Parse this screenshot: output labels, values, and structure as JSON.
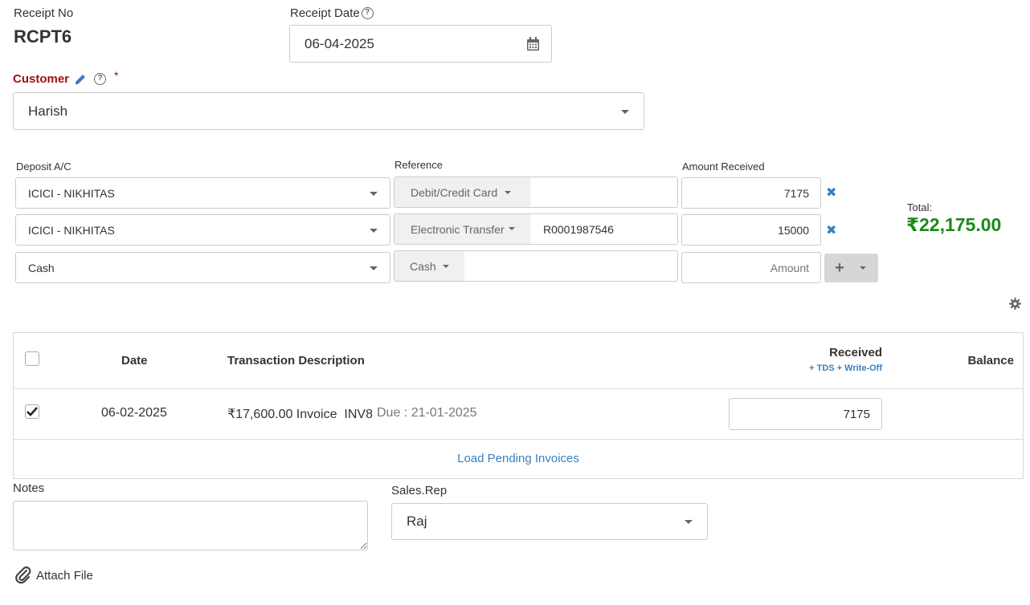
{
  "receipt": {
    "no_label": "Receipt No",
    "no_value": "RCPT6",
    "date_label": "Receipt Date",
    "date_value": "06-04-2025",
    "help_glyph": "?"
  },
  "customer": {
    "label": "Customer",
    "required_mark": "*",
    "value": "Harish"
  },
  "deposits": {
    "account_label": "Deposit A/C",
    "reference_label": "Reference",
    "amount_label": "Amount Received",
    "rows": [
      {
        "account": "ICICI - NIKHITAS",
        "method": "Debit/Credit Card",
        "reference": "",
        "amount": "7175"
      },
      {
        "account": "ICICI - NIKHITAS",
        "method": "Electronic Transfer",
        "reference": "R0001987546",
        "amount": "15000"
      },
      {
        "account": "Cash",
        "method": "Cash",
        "reference": "",
        "amount": ""
      }
    ],
    "amount_placeholder": "Amount",
    "remove_glyph": "✖",
    "add_glyph": "+"
  },
  "total": {
    "label": "Total:",
    "value": "₹22,175.00",
    "color": "#1a8a1a"
  },
  "table": {
    "headers": {
      "date": "Date",
      "description": "Transaction Description",
      "received": "Received",
      "received_sub": "+ TDS + Write-Off",
      "balance": "Balance"
    },
    "rows": [
      {
        "checked": true,
        "date": "06-02-2025",
        "description": "₹17,600.00 Invoice  INV8",
        "due": "Due : 21-01-2025",
        "received": "7175",
        "balance": ""
      }
    ],
    "load_link": "Load Pending Invoices"
  },
  "notes": {
    "label": "Notes",
    "value": ""
  },
  "sales_rep": {
    "label": "Sales.Rep",
    "value": "Raj"
  },
  "attach": {
    "label": "Attach File"
  },
  "colors": {
    "accent": "#3a7fc1",
    "required": "#a01010",
    "border": "#cccccc"
  }
}
